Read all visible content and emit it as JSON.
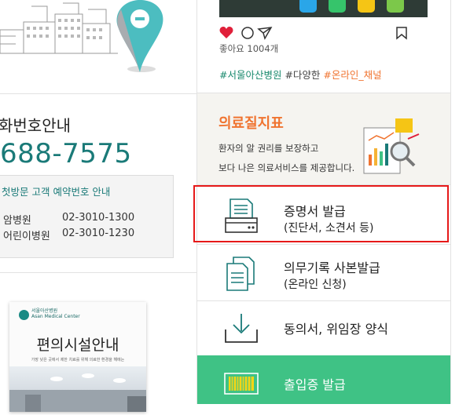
{
  "phone": {
    "title": "화번호안내",
    "number": "688-7575",
    "box_title": "첫방문 고객 예약번호 안내",
    "rows": [
      {
        "name": "암병원",
        "number": "02-3010-1300"
      },
      {
        "name": "어린이병원",
        "number": "02-3010-1230"
      }
    ]
  },
  "facility": {
    "org": "서울아산병원",
    "org_en": "Asan Medical Center",
    "title": "편의시설안내",
    "subtitle": "가장 낮은 곳에서 제한 치료를 위해 의료한 환경을 해에는"
  },
  "instagram": {
    "likes": "좋아요 1004개",
    "tags": [
      {
        "text": "#서울아산병원",
        "color": "#1a8a6e"
      },
      {
        "text": " #다양한 ",
        "color": "#444444"
      },
      {
        "text": "#온라인_채널",
        "color": "#f07430"
      }
    ]
  },
  "quality": {
    "title": "의료질지표",
    "desc1": "환자의 알 권리를 보장하고",
    "desc2": "보다 나은 의료서비스를 제공합니다."
  },
  "menu": [
    {
      "label": "증명서 발급",
      "sublabel": "(진단서, 소견서 등)",
      "icon": "certificate-printer-icon"
    },
    {
      "label": "의무기록 사본발급",
      "sublabel": "(온라인 신청)",
      "icon": "documents-copy-icon"
    },
    {
      "label": "동의서, 위임장 양식",
      "icon": "download-icon"
    },
    {
      "label": "출입증 발급",
      "icon": "barcode-icon"
    }
  ],
  "colors": {
    "accent": "#1a7a78",
    "orange": "#f07430",
    "green": "#3fc285",
    "highlight": "#e61919"
  }
}
